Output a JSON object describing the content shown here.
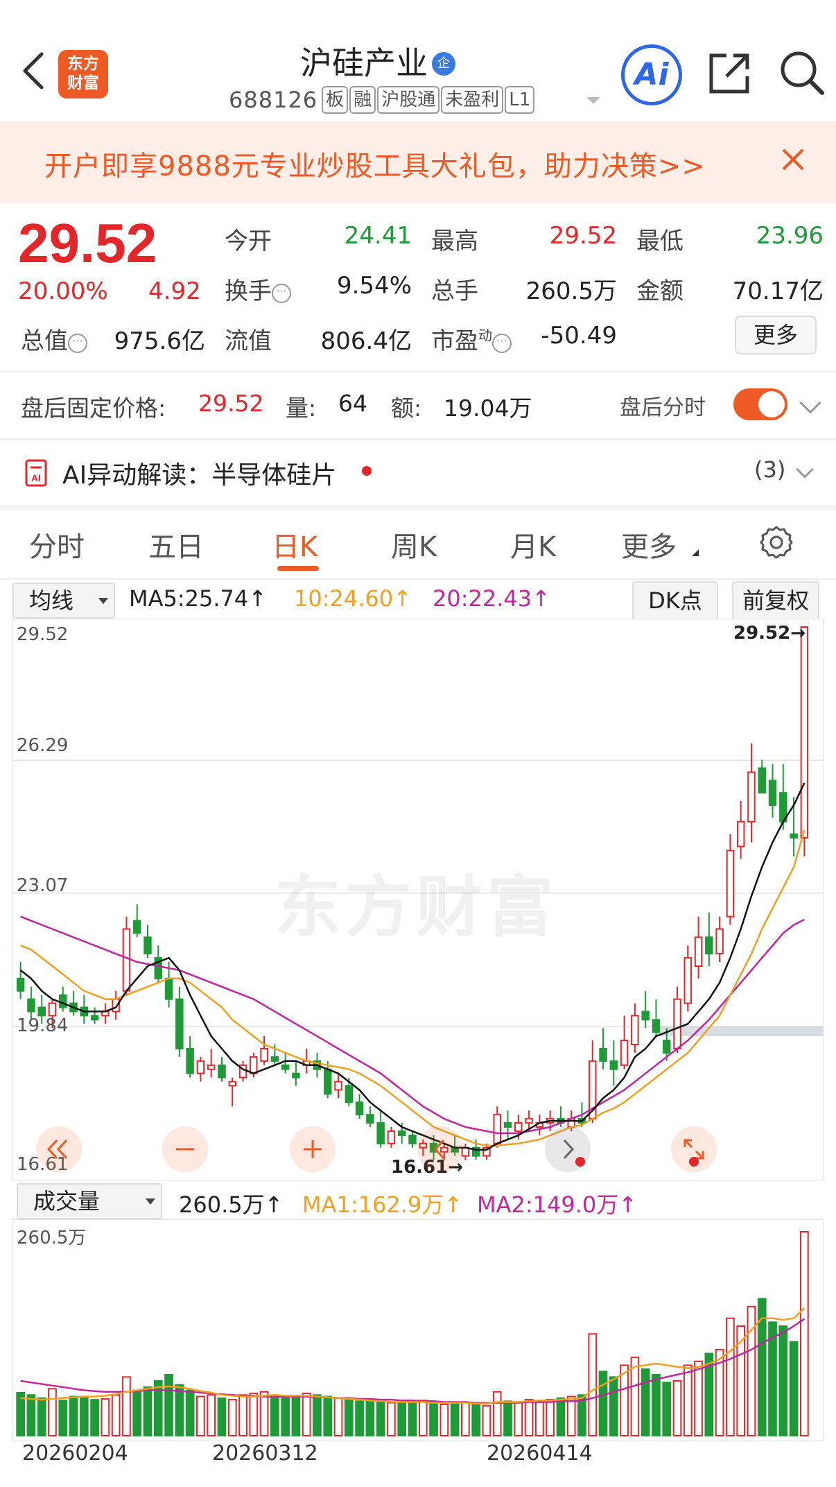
{
  "header": {
    "title": "沪硅产业",
    "title_badge": "企",
    "code": "688126",
    "tags": [
      "板",
      "融",
      "沪股通",
      "未盈利",
      "L1"
    ],
    "logo_line1": "东方",
    "logo_line2": "财富",
    "ai_label": "Ai"
  },
  "promo": {
    "text": "开户即享9888元专业炒股工具大礼包，助力决策>>"
  },
  "quote": {
    "price": "29.52",
    "pct": "20.00%",
    "change": "4.92",
    "open_label": "今开",
    "open": "24.41",
    "high_label": "最高",
    "high": "29.52",
    "low_label": "最低",
    "low": "23.96",
    "turnover_label": "换手",
    "turnover": "9.54%",
    "volume_label": "总手",
    "volume": "260.5万",
    "amount_label": "金额",
    "amount": "70.17亿",
    "mktcap_label": "总值",
    "mktcap": "975.6亿",
    "float_label": "流值",
    "float": "806.4亿",
    "pe_label": "市盈",
    "pe_sup": "动",
    "pe": "-50.49",
    "more": "更多"
  },
  "after_hours": {
    "price_label": "盘后固定价格:",
    "price": "29.52",
    "vol_label": "量:",
    "vol": "64",
    "amt_label": "额:",
    "amt": "19.04万",
    "toggle_label": "盘后分时",
    "toggle_on": true
  },
  "ai": {
    "label": "AI异动解读：半导体硅片",
    "count": "(3)"
  },
  "tabs": [
    {
      "label": "分时"
    },
    {
      "label": "五日"
    },
    {
      "label": "日K"
    },
    {
      "label": "周K"
    },
    {
      "label": "月K"
    },
    {
      "label": "更多"
    }
  ],
  "active_tab": "日K",
  "ma_legend": {
    "dropdown": "均线",
    "ma5": "MA5:25.74↑",
    "ma10": "10:24.60↑",
    "ma20": "20:22.43↑",
    "dk": "DK点",
    "adjust": "前复权"
  },
  "vol_legend": {
    "dropdown": "成交量",
    "vol": "260.5万↑",
    "ma1": "MA1:162.9万↑",
    "ma2": "MA2:149.0万↑",
    "axis_max": "260.5万"
  },
  "price_axis": [
    "29.52",
    "26.29",
    "23.07",
    "19.84",
    "16.61"
  ],
  "high_marker": "29.52→",
  "low_marker": "16.61→",
  "watermark": "东方财富",
  "dates": [
    "20260204",
    "20260312",
    "20260414"
  ],
  "colors": {
    "up": "#e2262a",
    "down": "#1e9b37",
    "accent": "#ee5a24",
    "ma5": "#111111",
    "ma10": "#f0a020",
    "ma20": "#c026a0"
  },
  "chart_data": {
    "type": "candlestick",
    "ylim": [
      16.61,
      29.52
    ],
    "note_candles": "open, high, low, close per trading day (approx.)",
    "candles": [
      [
        21.0,
        21.4,
        20.5,
        20.7
      ],
      [
        20.5,
        20.8,
        20.0,
        20.2
      ],
      [
        20.3,
        20.6,
        19.9,
        20.1
      ],
      [
        20.1,
        20.5,
        19.8,
        20.4
      ],
      [
        20.6,
        20.8,
        20.2,
        20.3
      ],
      [
        20.4,
        20.7,
        20.1,
        20.2
      ],
      [
        20.3,
        20.6,
        19.9,
        20.1
      ],
      [
        20.1,
        20.3,
        19.9,
        20.0
      ],
      [
        20.1,
        20.4,
        19.9,
        20.2
      ],
      [
        20.2,
        20.7,
        20.0,
        20.5
      ],
      [
        20.7,
        22.5,
        20.6,
        22.2
      ],
      [
        22.4,
        22.8,
        22.0,
        22.1
      ],
      [
        22.0,
        22.3,
        21.5,
        21.6
      ],
      [
        21.5,
        21.8,
        20.9,
        21.0
      ],
      [
        21.0,
        21.4,
        20.3,
        20.5
      ],
      [
        20.5,
        20.8,
        19.1,
        19.3
      ],
      [
        19.3,
        19.6,
        18.6,
        18.7
      ],
      [
        18.7,
        19.1,
        18.5,
        19.0
      ],
      [
        18.8,
        19.3,
        18.6,
        18.9
      ],
      [
        18.9,
        19.1,
        18.5,
        18.6
      ],
      [
        18.4,
        18.6,
        17.9,
        18.5
      ],
      [
        18.6,
        19.0,
        18.5,
        18.9
      ],
      [
        18.7,
        19.2,
        18.6,
        19.1
      ],
      [
        19.0,
        19.6,
        18.9,
        19.3
      ],
      [
        19.1,
        19.4,
        18.9,
        19.0
      ],
      [
        18.9,
        19.2,
        18.7,
        18.8
      ],
      [
        18.7,
        19.0,
        18.4,
        18.6
      ],
      [
        18.9,
        19.3,
        18.7,
        19.0
      ],
      [
        19.0,
        19.2,
        18.6,
        18.8
      ],
      [
        18.8,
        19.0,
        18.1,
        18.2
      ],
      [
        18.3,
        18.7,
        18.1,
        18.5
      ],
      [
        18.4,
        18.6,
        17.9,
        18.0
      ],
      [
        18.0,
        18.2,
        17.6,
        17.7
      ],
      [
        17.7,
        17.9,
        17.4,
        17.5
      ],
      [
        17.5,
        17.8,
        16.9,
        17.0
      ],
      [
        17.0,
        17.4,
        16.9,
        17.3
      ],
      [
        17.3,
        17.5,
        17.0,
        17.2
      ],
      [
        17.2,
        17.3,
        16.9,
        17.0
      ],
      [
        16.9,
        17.1,
        16.7,
        17.0
      ],
      [
        17.0,
        17.2,
        16.6,
        16.8
      ],
      [
        16.8,
        17.0,
        16.6,
        16.9
      ],
      [
        16.9,
        17.2,
        16.7,
        16.8
      ],
      [
        16.7,
        17.0,
        16.6,
        16.9
      ],
      [
        16.9,
        17.1,
        16.61,
        16.7
      ],
      [
        16.7,
        17.0,
        16.61,
        16.9
      ],
      [
        17.0,
        17.9,
        16.9,
        17.7
      ],
      [
        17.5,
        17.8,
        17.1,
        17.4
      ],
      [
        17.3,
        17.7,
        17.1,
        17.5
      ],
      [
        17.5,
        17.8,
        17.3,
        17.6
      ],
      [
        17.4,
        17.7,
        17.2,
        17.5
      ],
      [
        17.5,
        17.8,
        17.3,
        17.6
      ],
      [
        17.6,
        17.9,
        17.4,
        17.5
      ],
      [
        17.4,
        17.8,
        17.3,
        17.6
      ],
      [
        17.6,
        18.0,
        17.4,
        17.5
      ],
      [
        17.6,
        19.5,
        17.5,
        19.0
      ],
      [
        19.3,
        19.8,
        18.8,
        19.0
      ],
      [
        19.0,
        19.5,
        18.4,
        18.8
      ],
      [
        18.9,
        20.1,
        18.8,
        19.5
      ],
      [
        19.4,
        20.4,
        19.2,
        20.1
      ],
      [
        20.2,
        20.7,
        19.8,
        20.0
      ],
      [
        20.0,
        20.5,
        19.6,
        19.7
      ],
      [
        19.5,
        19.8,
        19.0,
        19.2
      ],
      [
        19.3,
        20.8,
        19.2,
        20.5
      ],
      [
        20.4,
        21.8,
        20.2,
        21.5
      ],
      [
        21.3,
        22.5,
        21.0,
        22.0
      ],
      [
        22.0,
        22.6,
        21.3,
        21.6
      ],
      [
        21.6,
        22.5,
        21.4,
        22.2
      ],
      [
        22.5,
        24.5,
        22.3,
        24.1
      ],
      [
        24.2,
        25.3,
        23.9,
        24.8
      ],
      [
        24.8,
        26.7,
        24.3,
        26.0
      ],
      [
        26.1,
        26.3,
        25.5,
        25.5
      ],
      [
        25.8,
        26.2,
        24.9,
        25.2
      ],
      [
        25.5,
        26.2,
        24.6,
        24.8
      ],
      [
        24.5,
        25.4,
        23.96,
        24.41
      ],
      [
        24.41,
        29.52,
        23.96,
        29.52
      ]
    ],
    "ma5": [
      21.2,
      21.0,
      20.7,
      20.5,
      20.4,
      20.3,
      20.2,
      20.2,
      20.2,
      20.3,
      20.7,
      21.0,
      21.3,
      21.4,
      21.5,
      21.2,
      20.6,
      20.1,
      19.6,
      19.3,
      19.0,
      18.8,
      18.7,
      18.8,
      18.9,
      19.0,
      19.0,
      18.9,
      18.9,
      18.8,
      18.7,
      18.5,
      18.3,
      18.0,
      17.8,
      17.6,
      17.4,
      17.3,
      17.2,
      17.1,
      17.0,
      16.9,
      16.9,
      16.85,
      16.85,
      17.0,
      17.1,
      17.2,
      17.35,
      17.5,
      17.55,
      17.55,
      17.55,
      17.55,
      17.8,
      18.1,
      18.3,
      18.6,
      19.1,
      19.3,
      19.6,
      19.7,
      19.8,
      19.9,
      20.2,
      20.5,
      20.9,
      21.5,
      22.2,
      23.0,
      23.7,
      24.3,
      24.8,
      25.2,
      25.74
    ],
    "ma10": [
      21.8,
      21.7,
      21.5,
      21.3,
      21.1,
      20.9,
      20.7,
      20.6,
      20.5,
      20.5,
      20.6,
      20.7,
      20.8,
      20.9,
      21.0,
      21.0,
      20.9,
      20.7,
      20.5,
      20.3,
      20.0,
      19.8,
      19.6,
      19.4,
      19.3,
      19.2,
      19.1,
      19.0,
      18.95,
      18.9,
      18.85,
      18.8,
      18.7,
      18.55,
      18.4,
      18.2,
      18.0,
      17.8,
      17.6,
      17.4,
      17.3,
      17.2,
      17.1,
      17.0,
      16.95,
      16.95,
      16.98,
      17.0,
      17.05,
      17.1,
      17.2,
      17.3,
      17.4,
      17.45,
      17.6,
      17.75,
      17.85,
      18.0,
      18.2,
      18.4,
      18.6,
      18.8,
      19.0,
      19.2,
      19.5,
      19.8,
      20.1,
      20.6,
      21.1,
      21.6,
      22.2,
      22.7,
      23.2,
      23.7,
      24.6
    ],
    "ma20": [
      22.5,
      22.4,
      22.3,
      22.2,
      22.1,
      22.0,
      21.9,
      21.8,
      21.7,
      21.6,
      21.5,
      21.4,
      21.35,
      21.3,
      21.25,
      21.2,
      21.1,
      21.0,
      20.9,
      20.8,
      20.7,
      20.6,
      20.5,
      20.35,
      20.2,
      20.05,
      19.9,
      19.75,
      19.6,
      19.45,
      19.3,
      19.15,
      19.0,
      18.85,
      18.7,
      18.5,
      18.3,
      18.1,
      17.9,
      17.75,
      17.6,
      17.5,
      17.4,
      17.35,
      17.3,
      17.25,
      17.25,
      17.25,
      17.3,
      17.35,
      17.4,
      17.5,
      17.6,
      17.7,
      17.85,
      18.0,
      18.15,
      18.3,
      18.5,
      18.7,
      18.9,
      19.1,
      19.3,
      19.5,
      19.75,
      20.0,
      20.3,
      20.6,
      20.9,
      21.2,
      21.5,
      21.8,
      22.1,
      22.3,
      22.43
    ],
    "volume_wan": [
      55,
      52,
      48,
      60,
      45,
      50,
      48,
      46,
      47,
      52,
      75,
      58,
      62,
      70,
      78,
      65,
      58,
      50,
      52,
      48,
      46,
      52,
      54,
      56,
      50,
      48,
      50,
      54,
      52,
      50,
      48,
      46,
      44,
      45,
      44,
      42,
      43,
      44,
      45,
      42,
      40,
      41,
      43,
      40,
      38,
      56,
      44,
      42,
      46,
      44,
      46,
      48,
      50,
      52,
      130,
      82,
      75,
      90,
      100,
      85,
      78,
      68,
      70,
      90,
      95,
      105,
      110,
      150,
      140,
      165,
      175,
      145,
      140,
      120,
      260.5
    ],
    "vol_ma1": [
      48,
      47,
      46,
      47,
      48,
      49,
      50,
      50,
      51,
      53,
      56,
      58,
      60,
      62,
      63,
      62,
      60,
      57,
      55,
      52,
      51,
      50,
      50,
      51,
      52,
      51,
      51,
      51,
      50,
      49,
      48,
      47,
      46,
      45,
      44,
      43,
      43,
      43,
      43,
      42,
      42,
      42,
      42,
      41,
      41,
      43,
      43,
      43,
      44,
      45,
      45,
      46,
      47,
      48,
      58,
      65,
      72,
      80,
      88,
      90,
      92,
      90,
      88,
      86,
      88,
      92,
      98,
      108,
      120,
      135,
      150,
      150,
      148,
      150,
      162.9
    ],
    "vol_ma2": [
      70,
      68,
      66,
      64,
      62,
      60,
      58,
      57,
      56,
      56,
      56,
      57,
      58,
      58,
      58,
      57,
      56,
      55,
      54,
      53,
      52,
      51,
      51,
      50,
      50,
      50,
      50,
      50,
      49,
      49,
      48,
      48,
      47,
      47,
      46,
      46,
      45,
      45,
      44,
      44,
      43,
      43,
      43,
      42,
      42,
      42,
      42,
      42,
      43,
      43,
      43,
      44,
      44,
      45,
      48,
      52,
      56,
      60,
      64,
      68,
      72,
      75,
      78,
      81,
      85,
      89,
      93,
      98,
      104,
      110,
      118,
      125,
      132,
      140,
      149.0
    ]
  }
}
